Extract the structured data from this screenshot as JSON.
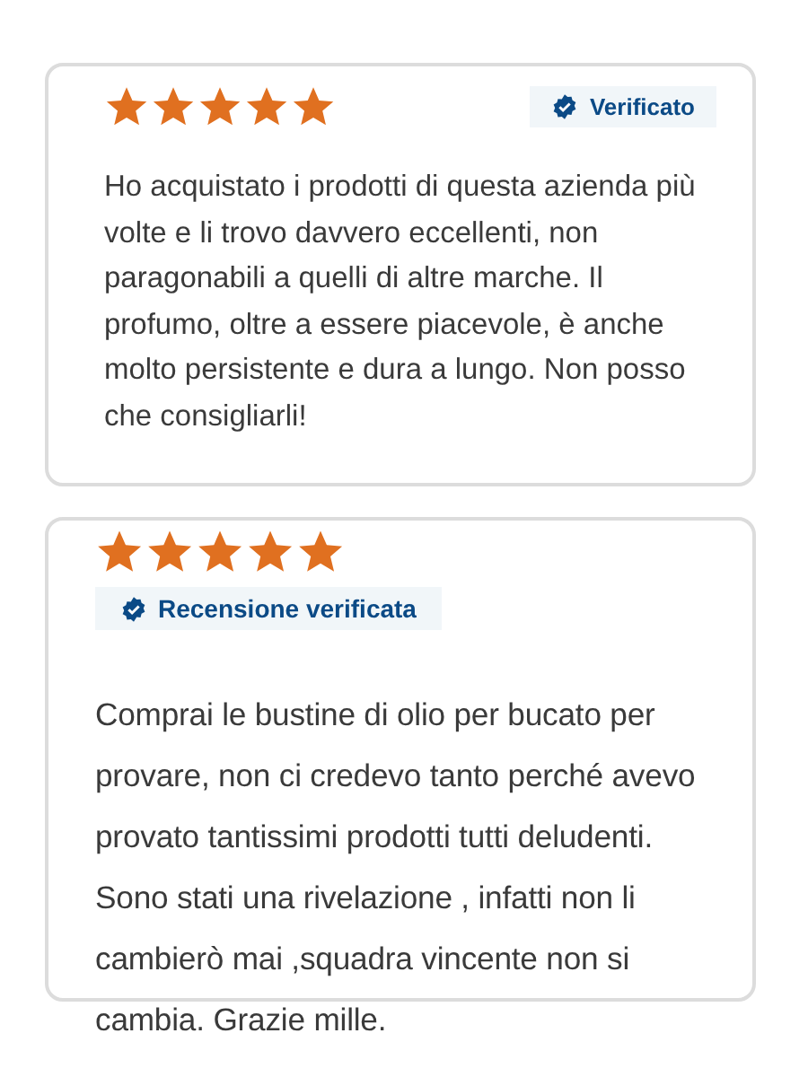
{
  "reviews": [
    {
      "kind": "inline",
      "stars": 5,
      "badge": "Verificato",
      "text": "Ho acquistato i prodotti di questa azienda più volte e li trovo davvero eccellenti, non paragonabili a quelli di altre marche. Il profumo, oltre a essere piacevole, è anche molto persistente e dura a lungo. Non posso che consigliarli!"
    },
    {
      "kind": "stacked",
      "stars": 5,
      "badge": "Recensione verificata",
      "text": "Comprai le bustine di olio per bucato per provare, non ci credevo tanto perché avevo provato tantissimi prodotti tutti deludenti. Sono stati una rivelazione , infatti non li cambierò mai ,squadra vincente non si cambia. Grazie mille."
    }
  ]
}
